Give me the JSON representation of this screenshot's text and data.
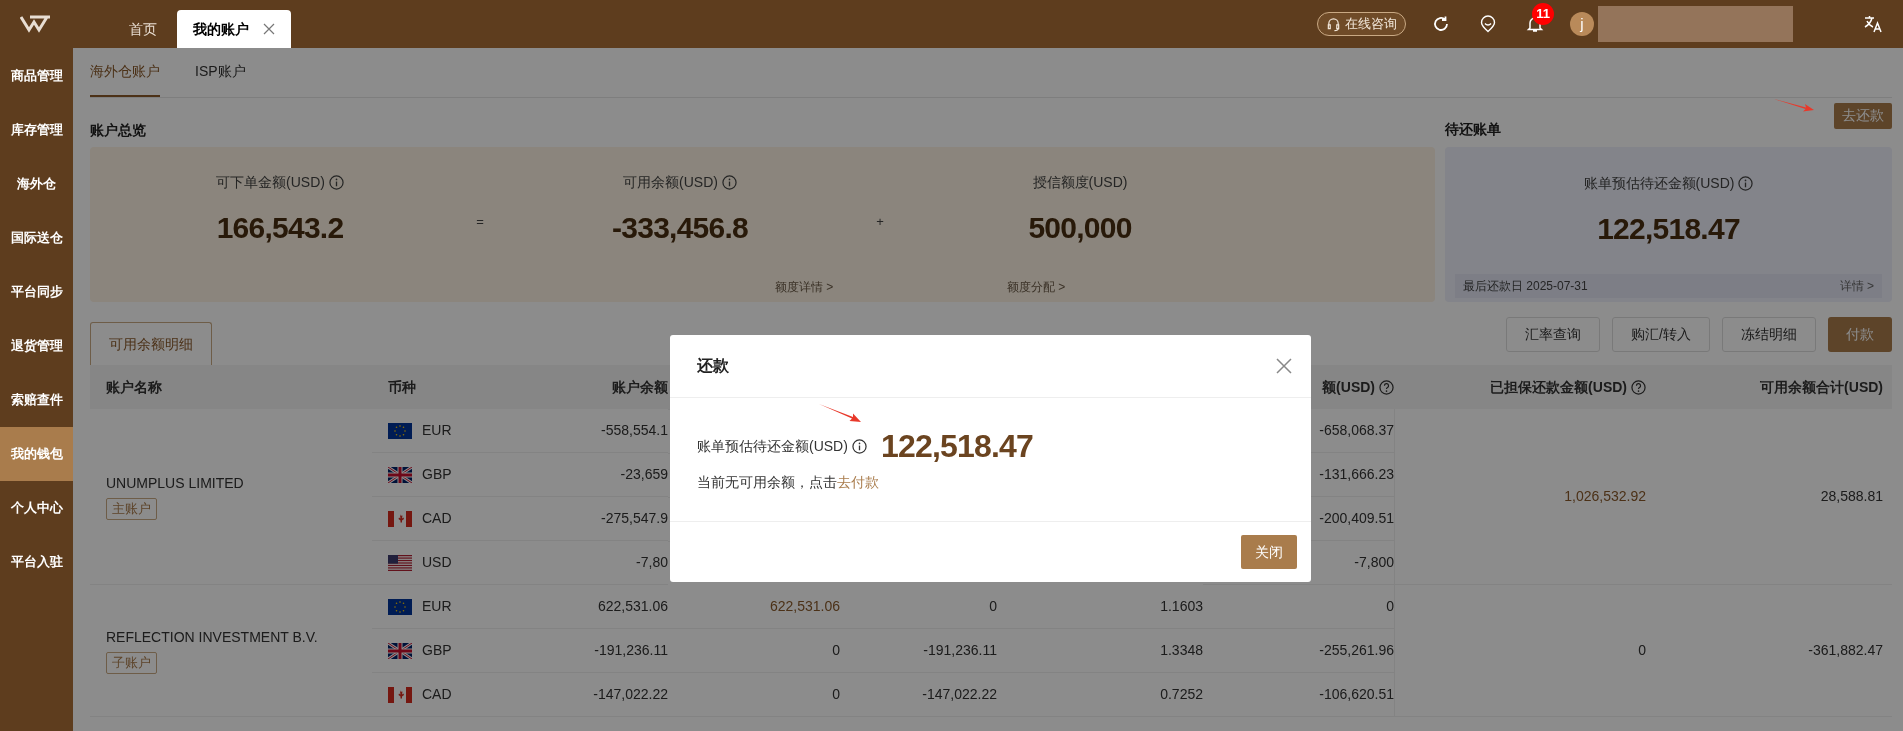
{
  "top_tabs": [
    {
      "label": "首页",
      "selected": false,
      "closable": false
    },
    {
      "label": "我的账户",
      "selected": true,
      "closable": true
    }
  ],
  "header": {
    "support_button": "在线咨询",
    "notification_count": "11",
    "avatar_letter": "j"
  },
  "sidebar": {
    "items": [
      {
        "label": "商品管理",
        "selected": false
      },
      {
        "label": "库存管理",
        "selected": false
      },
      {
        "label": "海外仓",
        "selected": false
      },
      {
        "label": "国际送仓",
        "selected": false
      },
      {
        "label": "平台同步",
        "selected": false
      },
      {
        "label": "退货管理",
        "selected": false
      },
      {
        "label": "索赔查件",
        "selected": false
      },
      {
        "label": "我的钱包",
        "selected": true
      },
      {
        "label": "个人中心",
        "selected": false
      },
      {
        "label": "平台入驻",
        "selected": false
      }
    ]
  },
  "account_tabs": [
    {
      "label": "海外仓账户",
      "selected": true
    },
    {
      "label": "ISP账户",
      "selected": false
    }
  ],
  "overview": {
    "title": "账户总览",
    "items": [
      {
        "label": "可下单金额(USD)",
        "info": true,
        "value": "166,543.2"
      },
      {
        "label": "可用余额(USD)",
        "info": true,
        "value": "-333,456.8"
      },
      {
        "label": "授信额度(USD)",
        "info": false,
        "value": "500,000"
      }
    ],
    "operators": [
      "=",
      "+"
    ],
    "links": [
      "额度详情 >",
      "额度分配 >"
    ]
  },
  "bill": {
    "title": "待还账单",
    "repay_button": "去还款",
    "label": "账单预估待还金额(USD)",
    "value": "122,518.47",
    "due_date": "最后还款日 2025-07-31",
    "details_link": "详情 >"
  },
  "detail_tabs": [
    {
      "label": "可用余额明细",
      "selected": true
    }
  ],
  "actions": [
    {
      "label": "汇率查询",
      "primary": false
    },
    {
      "label": "购汇/转入",
      "primary": false
    },
    {
      "label": "冻结明细",
      "primary": false
    },
    {
      "label": "付款",
      "primary": true
    }
  ],
  "table": {
    "columns": [
      {
        "label": "账户名称",
        "help": false
      },
      {
        "label": "币种",
        "help": false
      },
      {
        "label": "账户余额",
        "help": false
      },
      {
        "label": "额(USD)",
        "help": true
      },
      {
        "label": "已担保还款金额(USD)",
        "help": true
      },
      {
        "label": "可用余额合计(USD)",
        "help": false
      }
    ],
    "groups": [
      {
        "account_name": "UNUMPLUS LIMITED",
        "badge": "主账户",
        "guaranteed_repayment": {
          "text": "1,026,532.92",
          "link": true
        },
        "available_total": "28,588.81",
        "rows": [
          {
            "currency": "EUR",
            "kind": "eur",
            "account_balance": "-558,554.1",
            "usd_amount": "-658,068.37"
          },
          {
            "currency": "GBP",
            "kind": "gbp",
            "account_balance": "-23,659",
            "usd_amount": "-131,666.23"
          },
          {
            "currency": "CAD",
            "kind": "cad",
            "account_balance": "-275,547.9",
            "usd_amount": "-200,409.51"
          },
          {
            "currency": "USD",
            "kind": "usd",
            "account_balance": "-7,80",
            "usd_amount": "-7,800"
          }
        ]
      },
      {
        "account_name": "REFLECTION INVESTMENT B.V.",
        "badge": "子账户",
        "guaranteed_repayment": {
          "text": "0",
          "link": false
        },
        "available_total": "-361,882.47",
        "rows": [
          {
            "currency": "EUR",
            "kind": "eur",
            "account_balance": "622,531.06",
            "column_4": {
              "text": "622,531.06",
              "link": true
            },
            "column_5": "0",
            "column_6": "1.1603",
            "usd_amount": "0"
          },
          {
            "currency": "GBP",
            "kind": "gbp",
            "account_balance": "-191,236.11",
            "column_4": {
              "text": "0",
              "link": false
            },
            "column_5": "-191,236.11",
            "column_6": "1.3348",
            "usd_amount": "-255,261.96"
          },
          {
            "currency": "CAD",
            "kind": "cad",
            "account_balance": "-147,022.22",
            "column_4": {
              "text": "0",
              "link": false
            },
            "column_5": "-147,022.22",
            "column_6": "0.7252",
            "usd_amount": "-106,620.51"
          }
        ]
      }
    ]
  },
  "modal": {
    "title": "还款",
    "label": "账单预估待还金额(USD)",
    "value": "122,518.47",
    "notice": "当前无可用余额，点击",
    "notice_link": "去付款",
    "close_button": "关闭"
  }
}
